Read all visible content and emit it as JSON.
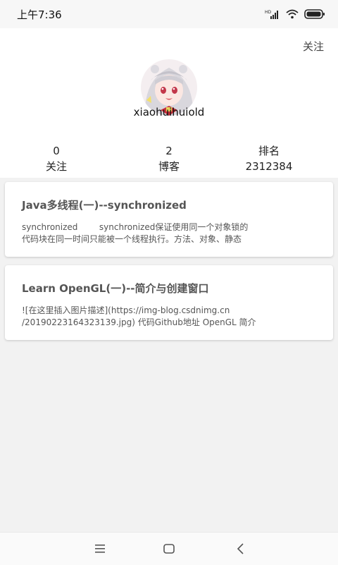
{
  "status_bar": {
    "time": "上午7:36",
    "icons": [
      "hd-icon",
      "signal-icon",
      "wifi-icon",
      "battery-icon"
    ]
  },
  "profile": {
    "follow_button": "关注",
    "username": "xiaohuihuiold",
    "stats": [
      {
        "value": "0",
        "label": "关注"
      },
      {
        "value": "2",
        "label": "博客"
      },
      {
        "value": "2312384",
        "label": "排名"
      }
    ]
  },
  "posts": [
    {
      "title": "Java多线程(一)--synchronized",
      "excerpt": "synchronized        synchronized保证使用同一个对象锁的\n代码块在同一时间只能被一个线程执行。方法、对象、静态"
    },
    {
      "title": "Learn OpenGL(一)--简介与创建窗口",
      "excerpt": "![在这里插入图片描述](https://img-blog.csdnimg.cn\n/20190223164323139.jpg) 代码Github地址 OpenGL 简介"
    }
  ],
  "navbar": {
    "icons": [
      "menu-icon",
      "home-icon",
      "back-icon"
    ]
  }
}
